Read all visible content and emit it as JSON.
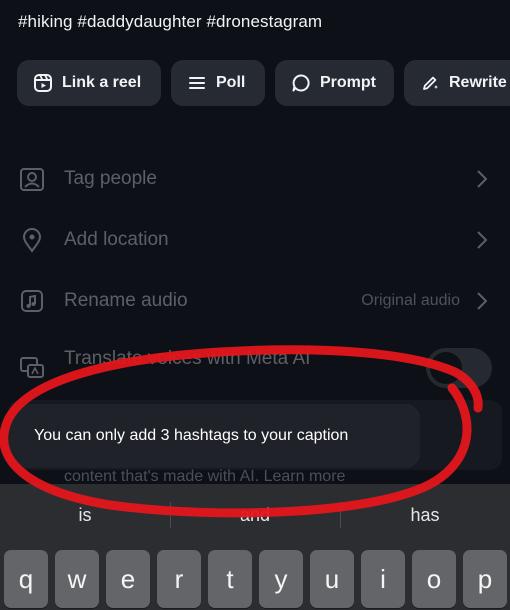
{
  "caption": "#hiking #daddydaughter #dronestagram",
  "chips": [
    {
      "label": "Link a reel",
      "icon": "reel-icon"
    },
    {
      "label": "Poll",
      "icon": "list-icon"
    },
    {
      "label": "Prompt",
      "icon": "chat-bubble-icon"
    },
    {
      "label": "Rewrite",
      "icon": "pen-sparkle-icon"
    }
  ],
  "options": {
    "tag_people": "Tag people",
    "add_location": "Add location",
    "rename_audio": "Rename audio",
    "audio_value": "Original audio",
    "translate": "Translate voices with Meta AI"
  },
  "ai_notice": "content that's made with AI. Learn more",
  "toast": "You can only add 3 hashtags to your caption",
  "keyboard": {
    "suggestions": [
      "is",
      "and",
      "has"
    ],
    "row1": [
      "q",
      "w",
      "e",
      "r",
      "t",
      "y",
      "u",
      "i",
      "o",
      "p"
    ]
  },
  "colors": {
    "background": "#0d1117",
    "chip": "#262a33",
    "annotation_circle": "#e3161b",
    "keyboard": "#2b2d31"
  }
}
